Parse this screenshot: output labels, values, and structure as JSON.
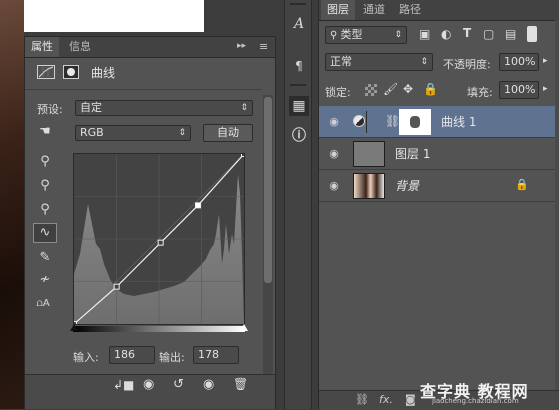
{
  "properties": {
    "tabs": [
      "属性",
      "信息"
    ],
    "panel_type_label": "曲线",
    "preset_label": "预设:",
    "preset_value": "自定",
    "channel_value": "RGB",
    "auto_button": "自动",
    "input_label": "输入:",
    "input_value": "186",
    "output_label": "输出:",
    "output_value": "178"
  },
  "curve": {
    "points": [
      [
        0,
        0
      ],
      [
        64,
        56
      ],
      [
        130,
        122
      ],
      [
        186,
        178
      ],
      [
        255,
        255
      ]
    ]
  },
  "tool_column": {
    "items": [
      "character-panel-icon",
      "paragraph-panel-icon",
      "properties-panel-icon",
      "info-panel-icon"
    ]
  },
  "layers": {
    "tabs": [
      "图层",
      "通道",
      "路径"
    ],
    "filter_label": "类型",
    "blend_mode": "正常",
    "opacity_label": "不透明度:",
    "opacity_value": "100%",
    "lock_label": "锁定:",
    "fill_label": "填充:",
    "fill_value": "100%",
    "rows": [
      {
        "name": "曲线 1",
        "selected": true
      },
      {
        "name": "图层 1",
        "selected": false
      },
      {
        "name": "背景",
        "selected": false
      }
    ]
  },
  "watermark": {
    "main": "查字典 教程网",
    "sub": "jiaocheng.chazidian.com"
  },
  "colors": {
    "panel_bg": "#535353",
    "selected_row": "#5f7391",
    "accent": "#ffffff"
  }
}
